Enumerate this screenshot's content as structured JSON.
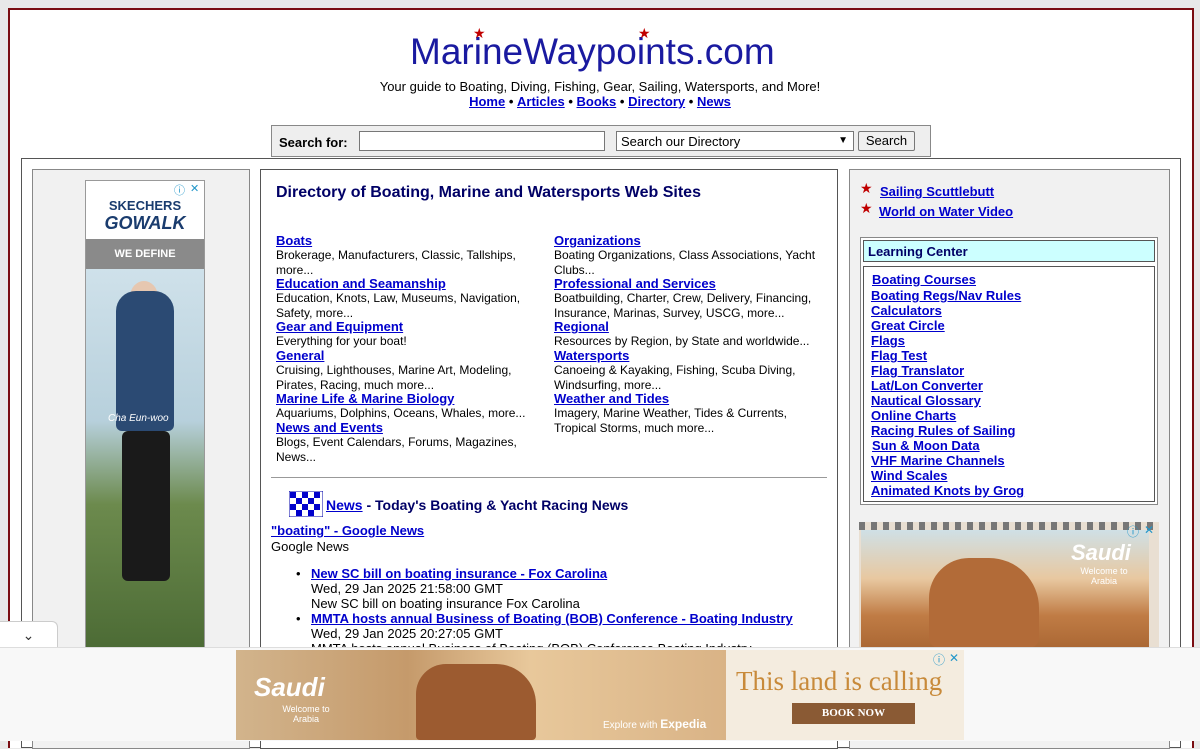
{
  "site": {
    "logo_text": "MarineWaypoints.com",
    "tagline": "Your guide to Boating, Diving, Fishing, Gear, Sailing, Watersports, and More!",
    "nav": [
      "Home",
      "Articles",
      "Books",
      "Directory",
      "News"
    ],
    "nav_sep": "•"
  },
  "search": {
    "label": "Search for:",
    "value": "",
    "scope_selected": "Search our Directory",
    "button": "Search"
  },
  "directory": {
    "title": "Directory of Boating, Marine and Watersports Web Sites",
    "left": [
      {
        "name": "Boats",
        "desc": "Brokerage, Manufacturers, Classic, Tallships, more..."
      },
      {
        "name": "Education and Seamanship",
        "desc": "Education, Knots, Law, Museums, Navigation, Safety, more..."
      },
      {
        "name": "Gear and Equipment",
        "desc": "Everything for your boat!"
      },
      {
        "name": "General",
        "desc": "Cruising, Lighthouses, Marine Art, Modeling, Pirates, Racing, much more..."
      },
      {
        "name": "Marine Life & Marine Biology",
        "desc": "Aquariums, Dolphins, Oceans, Whales, more..."
      },
      {
        "name": "News and Events",
        "desc": "Blogs, Event Calendars, Forums, Magazines, News..."
      }
    ],
    "right": [
      {
        "name": "Organizations",
        "desc": "Boating Organizations, Class Associations, Yacht Clubs..."
      },
      {
        "name": "Professional and Services",
        "desc": "Boatbuilding, Charter, Crew, Delivery, Financing, Insurance, Marinas, Survey, USCG, more..."
      },
      {
        "name": "Regional",
        "desc": "Resources by Region, by State and worldwide..."
      },
      {
        "name": "Watersports",
        "desc": "Canoeing & Kayaking, Fishing, Scuba Diving, Windsurfing, more..."
      },
      {
        "name": "Weather and Tides",
        "desc": "Imagery, Marine Weather, Tides & Currents, Tropical Storms, much more..."
      }
    ]
  },
  "news": {
    "link": "News",
    "heading_rest": " - Today's Boating & Yacht Racing News",
    "feed_title": "\"boating\" - Google News",
    "feed_source": "Google News",
    "items": [
      {
        "title": "New SC bill on boating insurance - Fox Carolina",
        "date": "Wed, 29 Jan 2025 21:58:00 GMT",
        "summary": "New SC bill on boating insurance  Fox Carolina"
      },
      {
        "title": "MMTA hosts annual Business of Boating (BOB) Conference - Boating Industry",
        "date": "Wed, 29 Jan 2025 20:27:05 GMT",
        "summary": "MMTA hosts annual Business of Boating (BOB) Conference  Boating Industry"
      }
    ]
  },
  "sidebar": {
    "top_links": [
      "Sailing Scuttlebutt",
      "World on Water Video"
    ],
    "learning_center": {
      "title": "Learning Center",
      "items": [
        "Boating Courses",
        "Boating Regs/Nav Rules",
        "Calculators",
        "Great Circle",
        "Flags",
        "Flag Test",
        "Flag Translator",
        "Lat/Lon Converter",
        "Nautical Glossary",
        "Online Charts",
        "Racing Rules of Sailing",
        "Sun & Moon Data",
        "VHF Marine Channels",
        "Wind Scales",
        "Animated Knots by Grog"
      ]
    }
  },
  "ads": {
    "skechers": {
      "brand_top": "SKECHERS",
      "brand_bottom": "GOWALK",
      "band": "WE DEFINE COMFORT",
      "person": "Cha Eun-woo"
    },
    "saudi_side": {
      "logo": "Saudi",
      "sub": "Welcome to Arabia"
    },
    "bottom": {
      "logo": "Saudi",
      "sub": "Welcome to Arabia",
      "explore": "Explore with",
      "expedia": "Expedia",
      "headline": "This land is calling",
      "cta": "BOOK NOW"
    }
  },
  "colors": {
    "border": "#7a0d12",
    "link": "#0000cc",
    "heading": "#000066",
    "learning_head_bg": "#ccffff",
    "star": "#c00000"
  }
}
